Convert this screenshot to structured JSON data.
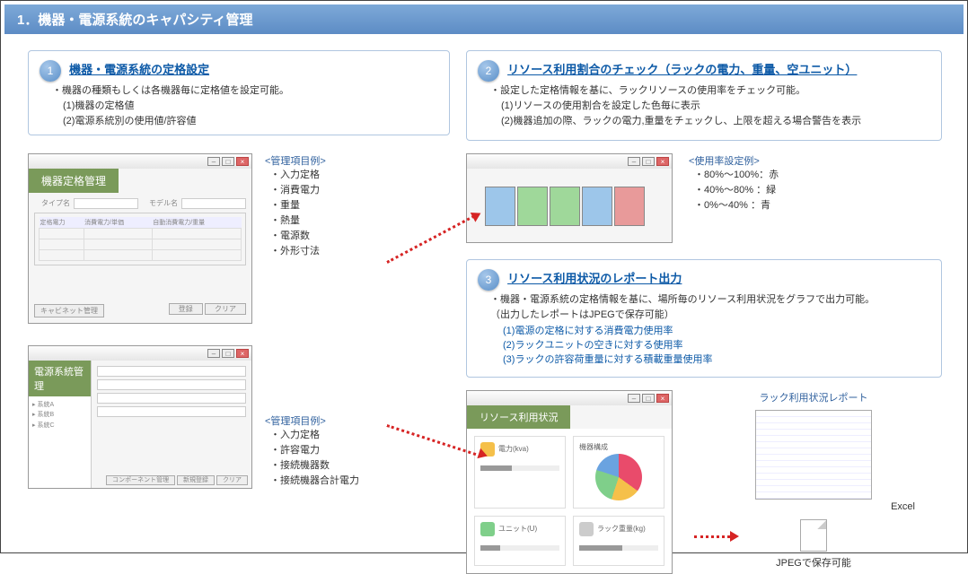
{
  "title": "1．機器・電源系統のキャパシティ管理",
  "section1": {
    "num": "1",
    "heading": "機器・電源系統の定格設定",
    "desc_intro": "・機器の種類もしくは各機器毎に定格値を設定可能。",
    "desc_1": "(1)機器の定格値",
    "desc_2": "(2)電源系統別の使用値/許容値",
    "mock1_title": "機器定格管理",
    "panel1_label": "<管理項目例>",
    "panel1_items": [
      "・入力定格",
      "・消費電力",
      "・重量",
      "・熱量",
      "・電源数",
      "・外形寸法"
    ],
    "mock2_title": "電源系統管理",
    "panel2_label": "<管理項目例>",
    "panel2_items": [
      "・入力定格",
      "・許容電力",
      "・接続機器数",
      "・接続機器合計電力"
    ]
  },
  "section2": {
    "num": "2",
    "heading": "リソース利用割合のチェック（ラックの電力、重量、空ユニット）",
    "desc_intro": "・設定した定格情報を基に、ラックリソースの使用率をチェック可能。",
    "desc_1": "(1)リソースの使用割合を設定した色毎に表示",
    "desc_2": "(2)機器追加の際、ラックの電力,重量をチェックし、上限を超える場合警告を表示",
    "legend_label": "<使用率設定例>",
    "legend_rows": [
      "・80%～100%：赤",
      "・40%～80% ：緑",
      "・0%～40%  ：青"
    ]
  },
  "section3": {
    "num": "3",
    "heading": "リソース利用状況のレポート出力",
    "desc_intro": "・機器・電源系統の定格情報を基に、場所毎のリソース利用状況をグラフで出力可能。",
    "desc_note": "（出力したレポートはJPEGで保存可能）",
    "sub_1": "(1)電源の定格に対する消費電力使用率",
    "sub_2": "(2)ラックユニットの空きに対する使用率",
    "sub_3": "(3)ラックの許容荷重量に対する積載重量使用率",
    "dash_title": "リソース利用状況",
    "dash_cards": [
      "電力(kva)",
      "機器構成",
      "ユニット(U)",
      "ラック重量(kg)"
    ],
    "report_title": "ラック利用状況レポート",
    "excel_label": "Excel",
    "jpeg_label": "JPEGで保存可能"
  }
}
